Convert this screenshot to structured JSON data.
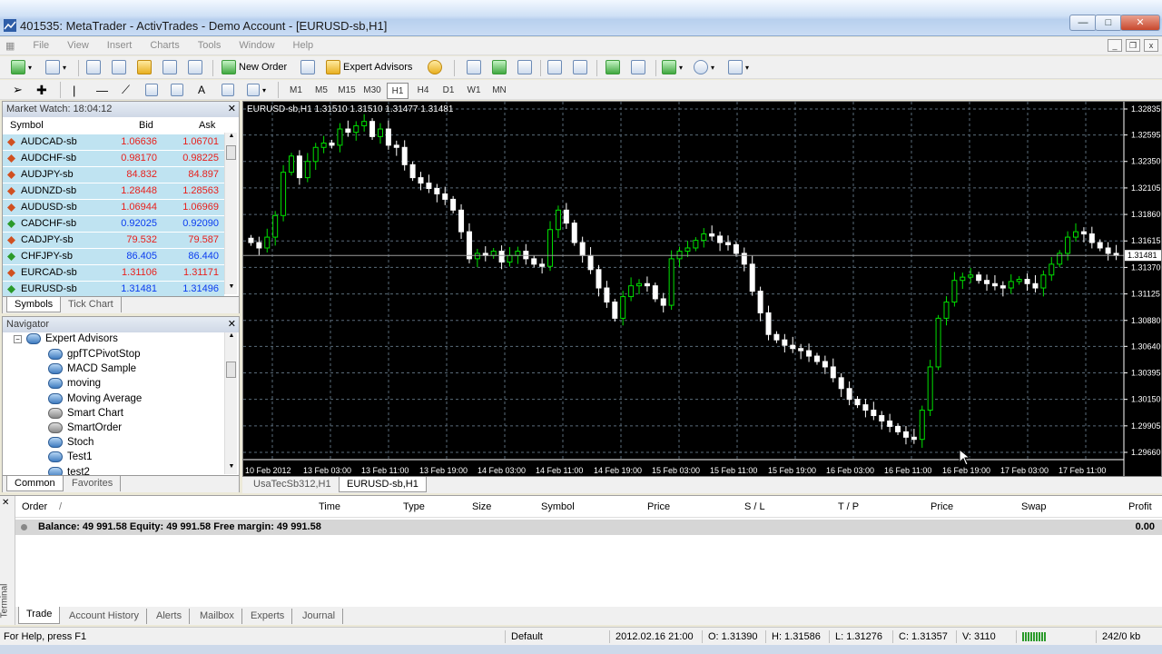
{
  "window": {
    "title": "401535: MetaTrader - ActivTrades - Demo Account - [EURUSD-sb,H1]"
  },
  "menu": [
    "File",
    "View",
    "Insert",
    "Charts",
    "Tools",
    "Window",
    "Help"
  ],
  "toolbar": {
    "new_order": "New Order",
    "expert_advisors": "Expert Advisors"
  },
  "timeframes": [
    "M1",
    "M5",
    "M15",
    "M30",
    "H1",
    "H4",
    "D1",
    "W1",
    "MN"
  ],
  "active_timeframe": "H1",
  "market_watch": {
    "title": "Market Watch: 18:04:12",
    "columns": {
      "symbol": "Symbol",
      "bid": "Bid",
      "ask": "Ask"
    },
    "rows": [
      {
        "symbol": "AUDCAD-sb",
        "bid": "1.06636",
        "ask": "1.06701",
        "dir": "down"
      },
      {
        "symbol": "AUDCHF-sb",
        "bid": "0.98170",
        "ask": "0.98225",
        "dir": "down"
      },
      {
        "symbol": "AUDJPY-sb",
        "bid": "84.832",
        "ask": "84.897",
        "dir": "down"
      },
      {
        "symbol": "AUDNZD-sb",
        "bid": "1.28448",
        "ask": "1.28563",
        "dir": "down"
      },
      {
        "symbol": "AUDUSD-sb",
        "bid": "1.06944",
        "ask": "1.06969",
        "dir": "down"
      },
      {
        "symbol": "CADCHF-sb",
        "bid": "0.92025",
        "ask": "0.92090",
        "dir": "up"
      },
      {
        "symbol": "CADJPY-sb",
        "bid": "79.532",
        "ask": "79.587",
        "dir": "down"
      },
      {
        "symbol": "CHFJPY-sb",
        "bid": "86.405",
        "ask": "86.440",
        "dir": "up"
      },
      {
        "symbol": "EURCAD-sb",
        "bid": "1.31106",
        "ask": "1.31171",
        "dir": "down"
      },
      {
        "symbol": "EURUSD-sb",
        "bid": "1.31481",
        "ask": "1.31496",
        "dir": "up"
      }
    ],
    "tabs": [
      "Symbols",
      "Tick Chart"
    ],
    "colors": {
      "up": "#0a3cf0",
      "down": "#e8201c",
      "row_bg": "#bfe3f1"
    }
  },
  "navigator": {
    "title": "Navigator",
    "root": "Expert Advisors",
    "items": [
      {
        "label": "gpfTCPivotStop",
        "icon": "expert-icon"
      },
      {
        "label": "MACD Sample",
        "icon": "expert-icon"
      },
      {
        "label": "moving",
        "icon": "expert-icon"
      },
      {
        "label": "Moving Average",
        "icon": "expert-icon"
      },
      {
        "label": "Smart Chart",
        "icon": "expert-disabled-icon"
      },
      {
        "label": "SmartOrder",
        "icon": "expert-disabled-icon"
      },
      {
        "label": "Stoch",
        "icon": "expert-icon"
      },
      {
        "label": "Test1",
        "icon": "expert-icon"
      },
      {
        "label": "test2",
        "icon": "expert-icon"
      }
    ],
    "tabs": [
      "Common",
      "Favorites"
    ]
  },
  "chart": {
    "legend": "EURUSD-sb,H1  1.31510 1.31510 1.31477 1.31481",
    "tabs": [
      "UsaTecSb312,H1",
      "EURUSD-sb,H1"
    ],
    "active_tab": "EURUSD-sb,H1",
    "colors": {
      "background": "#000000",
      "candle_up": "#00e000",
      "candle_down": "#ffffff",
      "grid": "#5a6b7a",
      "text": "#ffffff",
      "bid_line": "#9a9a9a"
    }
  },
  "chart_data": {
    "type": "candlestick",
    "symbol": "EURUSD-sb",
    "timeframe": "H1",
    "current_price": "1.31481",
    "y_ticks": [
      "1.32835",
      "1.32595",
      "1.32350",
      "1.32105",
      "1.31860",
      "1.31615",
      "1.31370",
      "1.31125",
      "1.30880",
      "1.30640",
      "1.30395",
      "1.30150",
      "1.29905",
      "1.29660"
    ],
    "ylim": [
      1.2966,
      1.32835
    ],
    "x_ticks": [
      "10 Feb 2012",
      "13 Feb 03:00",
      "13 Feb 11:00",
      "13 Feb 19:00",
      "14 Feb 03:00",
      "14 Feb 11:00",
      "14 Feb 19:00",
      "15 Feb 03:00",
      "15 Feb 11:00",
      "15 Feb 19:00",
      "16 Feb 03:00",
      "16 Feb 11:00",
      "16 Feb 19:00",
      "17 Feb 03:00",
      "17 Feb 11:00"
    ],
    "close": [
      1.316,
      1.3155,
      1.3165,
      1.3185,
      1.3225,
      1.324,
      1.322,
      1.3235,
      1.3248,
      1.3252,
      1.325,
      1.3265,
      1.3262,
      1.3268,
      1.3272,
      1.3258,
      1.3265,
      1.325,
      1.3248,
      1.3232,
      1.322,
      1.3215,
      1.321,
      1.3205,
      1.32,
      1.319,
      1.317,
      1.3145,
      1.315,
      1.3148,
      1.3152,
      1.3142,
      1.3148,
      1.3152,
      1.3145,
      1.314,
      1.3138,
      1.3172,
      1.319,
      1.3178,
      1.316,
      1.3148,
      1.3135,
      1.3118,
      1.3105,
      1.309,
      1.311,
      1.312,
      1.3122,
      1.312,
      1.3108,
      1.3102,
      1.3145,
      1.3152,
      1.3155,
      1.3162,
      1.3168,
      1.3166,
      1.316,
      1.3158,
      1.315,
      1.314,
      1.3115,
      1.3095,
      1.3075,
      1.307,
      1.3065,
      1.3062,
      1.306,
      1.3055,
      1.305,
      1.3045,
      1.3035,
      1.3025,
      1.3015,
      1.301,
      1.3005,
      1.3,
      1.2995,
      1.299,
      1.2985,
      1.298,
      1.2978,
      1.3005,
      1.3045,
      1.309,
      1.3105,
      1.3125,
      1.3128,
      1.313,
      1.3125,
      1.3122,
      1.312,
      1.3118,
      1.3124,
      1.3126,
      1.3122,
      1.3118,
      1.313,
      1.314,
      1.315,
      1.3165,
      1.317,
      1.3168,
      1.316,
      1.3155,
      1.315,
      1.3148
    ]
  },
  "terminal": {
    "columns": [
      "Order",
      "Time",
      "Type",
      "Size",
      "Symbol",
      "Price",
      "S / L",
      "T / P",
      "Price",
      "Swap",
      "Profit"
    ],
    "balance_line": "Balance: 49 991.58  Equity: 49 991.58  Free margin: 49 991.58",
    "profit": "0.00",
    "side_label": "Terminal",
    "tabs": [
      "Trade",
      "Account History",
      "Alerts",
      "Mailbox",
      "Experts",
      "Journal"
    ]
  },
  "statusbar": {
    "help": "For Help, press F1",
    "profile": "Default",
    "datetime": "2012.02.16 21:00",
    "open": "O: 1.31390",
    "high": "H: 1.31586",
    "low": "L: 1.31276",
    "close": "C: 1.31357",
    "volume": "V: 3110",
    "traffic": "242/0 kb"
  }
}
